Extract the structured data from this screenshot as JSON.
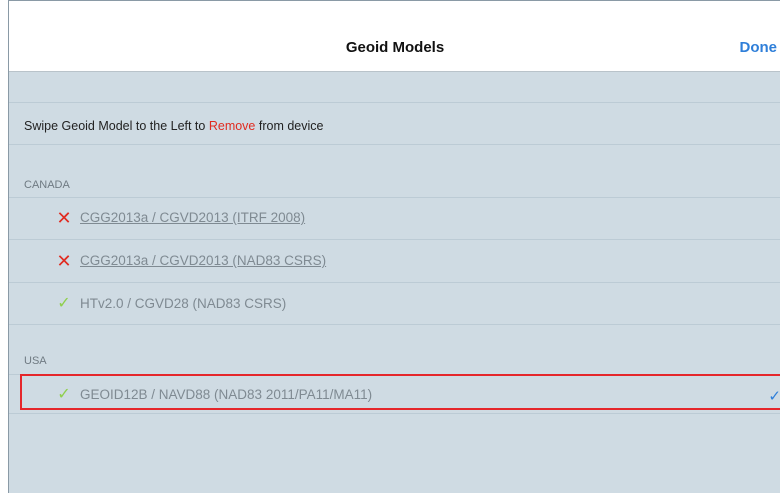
{
  "navbar": {
    "title": "Geoid Models",
    "done_label": "Done"
  },
  "instructions": {
    "prefix": "Swipe Geoid Model to the Left to ",
    "highlight": "Remove",
    "suffix": " from device"
  },
  "sections": [
    {
      "header": "CANADA",
      "items": [
        {
          "label": "CGG2013a / CGVD2013 (ITRF 2008)",
          "status": "not-installed",
          "status_glyph": "✕"
        },
        {
          "label": "CGG2013a / CGVD2013 (NAD83 CSRS)",
          "status": "not-installed",
          "status_glyph": "✕"
        },
        {
          "label": "HTv2.0 / CGVD28 (NAD83 CSRS)",
          "status": "installed",
          "status_glyph": "✓"
        }
      ]
    },
    {
      "header": "USA",
      "items": [
        {
          "label": "GEOID12B / NAVD88 (NAD83 2011/PA11/MA11)",
          "status": "installed",
          "status_glyph": "✓",
          "selected": true,
          "selected_glyph": "✓"
        }
      ]
    }
  ],
  "colors": {
    "accent": "#2f7fd9",
    "remove": "#e02b20",
    "installed": "#8fcf4d",
    "highlight_box": "#e5262b"
  }
}
